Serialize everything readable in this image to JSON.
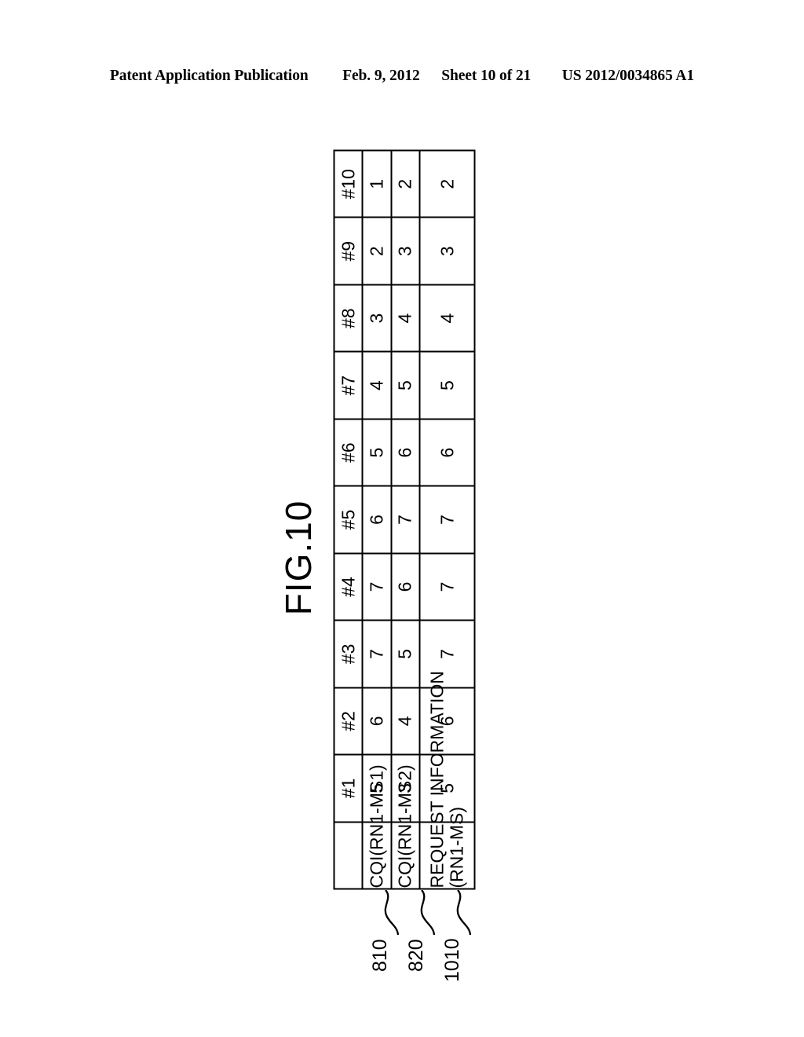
{
  "header": {
    "publication": "Patent Application Publication",
    "date": "Feb. 9, 2012",
    "sheet": "Sheet 10 of 21",
    "pub_number": "US 2012/0034865 A1"
  },
  "figure": {
    "label": "FIG.10"
  },
  "chart_data": {
    "type": "table",
    "title": "FIG.10",
    "orientation": "rotated-90-ccw",
    "corner_label": "",
    "categories": [
      "#1",
      "#2",
      "#3",
      "#4",
      "#5",
      "#6",
      "#7",
      "#8",
      "#9",
      "#10"
    ],
    "series": [
      {
        "name": "CQI(RN1-MS1)",
        "label_line1": "CQI(RN1-MS1)",
        "label_line2": "",
        "ref": "810",
        "values": [
          5,
          6,
          7,
          7,
          6,
          5,
          4,
          3,
          2,
          1
        ]
      },
      {
        "name": "CQI(RN1-MS2)",
        "label_line1": "CQI(RN1-MS2)",
        "label_line2": "",
        "ref": "820",
        "values": [
          3,
          4,
          5,
          6,
          7,
          6,
          5,
          4,
          3,
          2
        ]
      },
      {
        "name": "REQUEST INFORMATION (RN1-MS)",
        "label_line1": "REQUEST INFORMATION",
        "label_line2": "(RN1-MS)",
        "ref": "1010",
        "values": [
          5,
          6,
          7,
          7,
          7,
          6,
          5,
          4,
          3,
          2
        ]
      }
    ],
    "xlabel": "",
    "ylabel": "",
    "grid": true,
    "legend": "none"
  },
  "callouts": [
    {
      "ref": "810"
    },
    {
      "ref": "820"
    },
    {
      "ref": "1010"
    }
  ],
  "colors": {
    "line": "#000000",
    "background": "#ffffff",
    "text": "#000000"
  }
}
